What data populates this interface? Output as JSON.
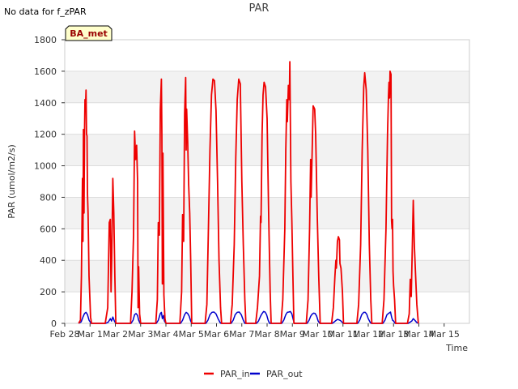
{
  "note": "No data for f_zPAR",
  "badge": "BA_met",
  "colors": {
    "PAR_in": "#ee0000",
    "PAR_out": "#0000cc",
    "band": "#f2f2f2",
    "grid": "#dddddd",
    "badge_fill": "#ffffcc",
    "badge_text": "#990000"
  },
  "chart_data": {
    "type": "line",
    "title": "PAR",
    "xlabel": "Time",
    "ylabel": "PAR (umol/m2/s)",
    "ylim": [
      0,
      1800
    ],
    "xlim": [
      0,
      16
    ],
    "yticks": [
      0,
      200,
      400,
      600,
      800,
      1000,
      1200,
      1400,
      1600,
      1800
    ],
    "xticks": [
      {
        "x": 0,
        "label": "Feb 28"
      },
      {
        "x": 1,
        "label": "Mar 1"
      },
      {
        "x": 2,
        "label": "Mar 2"
      },
      {
        "x": 3,
        "label": "Mar 3"
      },
      {
        "x": 4,
        "label": "Mar 4"
      },
      {
        "x": 5,
        "label": "Mar 5"
      },
      {
        "x": 6,
        "label": "Mar 6"
      },
      {
        "x": 7,
        "label": "Mar 7"
      },
      {
        "x": 8,
        "label": "Mar 8"
      },
      {
        "x": 9,
        "label": "Mar 9"
      },
      {
        "x": 10,
        "label": "Mar 10"
      },
      {
        "x": 11,
        "label": "Mar 11"
      },
      {
        "x": 12,
        "label": "Mar 12"
      },
      {
        "x": 13,
        "label": "Mar 13"
      },
      {
        "x": 14,
        "label": "Mar 14"
      },
      {
        "x": 15,
        "label": "Mar 15"
      }
    ],
    "grid": true,
    "legend_position": "bottom",
    "series": [
      {
        "name": "PAR_in",
        "points": [
          [
            0.55,
            0
          ],
          [
            0.62,
            20
          ],
          [
            0.66,
            300
          ],
          [
            0.7,
            920
          ],
          [
            0.72,
            520
          ],
          [
            0.74,
            1230
          ],
          [
            0.76,
            700
          ],
          [
            0.78,
            1200
          ],
          [
            0.8,
            1420
          ],
          [
            0.82,
            1360
          ],
          [
            0.84,
            1480
          ],
          [
            0.86,
            1200
          ],
          [
            0.88,
            1190
          ],
          [
            0.9,
            820
          ],
          [
            0.92,
            700
          ],
          [
            0.96,
            300
          ],
          [
            1.02,
            40
          ],
          [
            1.06,
            0
          ],
          [
            1.6,
            0
          ],
          [
            1.7,
            100
          ],
          [
            1.76,
            640
          ],
          [
            1.8,
            660
          ],
          [
            1.83,
            200
          ],
          [
            1.86,
            420
          ],
          [
            1.9,
            920
          ],
          [
            1.94,
            700
          ],
          [
            1.98,
            300
          ],
          [
            2.02,
            0
          ],
          [
            2.6,
            0
          ],
          [
            2.66,
            200
          ],
          [
            2.72,
            560
          ],
          [
            2.76,
            1220
          ],
          [
            2.8,
            1040
          ],
          [
            2.84,
            1130
          ],
          [
            2.88,
            900
          ],
          [
            2.9,
            100
          ],
          [
            2.92,
            360
          ],
          [
            2.96,
            60
          ],
          [
            3.0,
            0
          ],
          [
            3.6,
            0
          ],
          [
            3.66,
            150
          ],
          [
            3.7,
            640
          ],
          [
            3.74,
            560
          ],
          [
            3.78,
            1360
          ],
          [
            3.82,
            1550
          ],
          [
            3.84,
            1200
          ],
          [
            3.86,
            250
          ],
          [
            3.88,
            1080
          ],
          [
            3.92,
            180
          ],
          [
            3.96,
            30
          ],
          [
            4.0,
            0
          ],
          [
            4.55,
            0
          ],
          [
            4.62,
            200
          ],
          [
            4.66,
            690
          ],
          [
            4.7,
            520
          ],
          [
            4.74,
            1330
          ],
          [
            4.78,
            1560
          ],
          [
            4.8,
            1100
          ],
          [
            4.82,
            1360
          ],
          [
            4.86,
            1150
          ],
          [
            4.9,
            880
          ],
          [
            4.94,
            700
          ],
          [
            4.98,
            400
          ],
          [
            5.02,
            0
          ],
          [
            5.55,
            0
          ],
          [
            5.62,
            120
          ],
          [
            5.68,
            600
          ],
          [
            5.74,
            1100
          ],
          [
            5.8,
            1450
          ],
          [
            5.86,
            1550
          ],
          [
            5.92,
            1540
          ],
          [
            5.98,
            1350
          ],
          [
            6.04,
            900
          ],
          [
            6.1,
            400
          ],
          [
            6.16,
            100
          ],
          [
            6.2,
            0
          ],
          [
            6.55,
            0
          ],
          [
            6.62,
            120
          ],
          [
            6.7,
            500
          ],
          [
            6.76,
            1050
          ],
          [
            6.82,
            1420
          ],
          [
            6.88,
            1550
          ],
          [
            6.94,
            1520
          ],
          [
            7.0,
            900
          ],
          [
            7.06,
            500
          ],
          [
            7.12,
            150
          ],
          [
            7.16,
            0
          ],
          [
            7.55,
            0
          ],
          [
            7.62,
            100
          ],
          [
            7.7,
            300
          ],
          [
            7.74,
            680
          ],
          [
            7.76,
            640
          ],
          [
            7.8,
            1200
          ],
          [
            7.84,
            1450
          ],
          [
            7.88,
            1530
          ],
          [
            7.94,
            1500
          ],
          [
            8.0,
            1300
          ],
          [
            8.06,
            700
          ],
          [
            8.12,
            200
          ],
          [
            8.16,
            0
          ],
          [
            8.55,
            0
          ],
          [
            8.62,
            150
          ],
          [
            8.7,
            600
          ],
          [
            8.74,
            1100
          ],
          [
            8.78,
            1420
          ],
          [
            8.8,
            1280
          ],
          [
            8.84,
            1510
          ],
          [
            8.88,
            1420
          ],
          [
            8.9,
            1660
          ],
          [
            8.94,
            900
          ],
          [
            8.98,
            650
          ],
          [
            9.02,
            300
          ],
          [
            9.06,
            0
          ],
          [
            9.55,
            0
          ],
          [
            9.62,
            150
          ],
          [
            9.68,
            600
          ],
          [
            9.72,
            1040
          ],
          [
            9.74,
            800
          ],
          [
            9.78,
            1070
          ],
          [
            9.82,
            1380
          ],
          [
            9.88,
            1360
          ],
          [
            9.92,
            1200
          ],
          [
            9.98,
            700
          ],
          [
            10.04,
            300
          ],
          [
            10.1,
            0
          ],
          [
            10.55,
            0
          ],
          [
            10.62,
            100
          ],
          [
            10.68,
            300
          ],
          [
            10.72,
            400
          ],
          [
            10.74,
            350
          ],
          [
            10.78,
            520
          ],
          [
            10.82,
            550
          ],
          [
            10.86,
            530
          ],
          [
            10.88,
            380
          ],
          [
            10.92,
            350
          ],
          [
            10.98,
            200
          ],
          [
            11.02,
            0
          ],
          [
            11.55,
            0
          ],
          [
            11.62,
            120
          ],
          [
            11.7,
            500
          ],
          [
            11.76,
            1100
          ],
          [
            11.82,
            1500
          ],
          [
            11.86,
            1590
          ],
          [
            11.92,
            1480
          ],
          [
            11.98,
            1100
          ],
          [
            12.04,
            500
          ],
          [
            12.1,
            150
          ],
          [
            12.14,
            0
          ],
          [
            12.55,
            0
          ],
          [
            12.62,
            150
          ],
          [
            12.7,
            600
          ],
          [
            12.76,
            1200
          ],
          [
            12.8,
            1450
          ],
          [
            12.82,
            1530
          ],
          [
            12.84,
            1430
          ],
          [
            12.86,
            1600
          ],
          [
            12.9,
            1580
          ],
          [
            12.92,
            650
          ],
          [
            12.94,
            600
          ],
          [
            12.96,
            660
          ],
          [
            12.98,
            330
          ],
          [
            13.0,
            240
          ],
          [
            13.04,
            150
          ],
          [
            13.08,
            0
          ],
          [
            13.55,
            0
          ],
          [
            13.62,
            60
          ],
          [
            13.66,
            280
          ],
          [
            13.7,
            170
          ],
          [
            13.74,
            480
          ],
          [
            13.78,
            780
          ],
          [
            13.82,
            500
          ],
          [
            13.86,
            350
          ],
          [
            13.92,
            120
          ],
          [
            13.98,
            0
          ]
        ]
      },
      {
        "name": "PAR_out",
        "points": [
          [
            0.55,
            0
          ],
          [
            0.65,
            10
          ],
          [
            0.72,
            40
          ],
          [
            0.78,
            62
          ],
          [
            0.84,
            70
          ],
          [
            0.9,
            55
          ],
          [
            0.96,
            20
          ],
          [
            1.04,
            0
          ],
          [
            1.62,
            0
          ],
          [
            1.72,
            8
          ],
          [
            1.8,
            30
          ],
          [
            1.85,
            15
          ],
          [
            1.9,
            40
          ],
          [
            1.96,
            15
          ],
          [
            2.02,
            0
          ],
          [
            2.62,
            0
          ],
          [
            2.7,
            20
          ],
          [
            2.76,
            55
          ],
          [
            2.82,
            62
          ],
          [
            2.88,
            50
          ],
          [
            2.92,
            20
          ],
          [
            2.98,
            0
          ],
          [
            3.62,
            0
          ],
          [
            3.7,
            20
          ],
          [
            3.78,
            62
          ],
          [
            3.82,
            70
          ],
          [
            3.86,
            30
          ],
          [
            3.9,
            50
          ],
          [
            3.94,
            15
          ],
          [
            4.0,
            0
          ],
          [
            4.58,
            0
          ],
          [
            4.66,
            20
          ],
          [
            4.74,
            55
          ],
          [
            4.8,
            70
          ],
          [
            4.86,
            62
          ],
          [
            4.92,
            45
          ],
          [
            4.98,
            15
          ],
          [
            5.02,
            0
          ],
          [
            5.58,
            0
          ],
          [
            5.66,
            20
          ],
          [
            5.74,
            55
          ],
          [
            5.82,
            70
          ],
          [
            5.9,
            72
          ],
          [
            5.98,
            60
          ],
          [
            6.06,
            30
          ],
          [
            6.14,
            5
          ],
          [
            6.18,
            0
          ],
          [
            6.58,
            0
          ],
          [
            6.66,
            20
          ],
          [
            6.74,
            55
          ],
          [
            6.82,
            70
          ],
          [
            6.9,
            72
          ],
          [
            6.98,
            55
          ],
          [
            7.06,
            20
          ],
          [
            7.12,
            0
          ],
          [
            7.58,
            0
          ],
          [
            7.66,
            15
          ],
          [
            7.74,
            45
          ],
          [
            7.8,
            62
          ],
          [
            7.86,
            75
          ],
          [
            7.92,
            72
          ],
          [
            7.98,
            55
          ],
          [
            8.04,
            20
          ],
          [
            8.1,
            0
          ],
          [
            8.58,
            0
          ],
          [
            8.66,
            20
          ],
          [
            8.74,
            55
          ],
          [
            8.8,
            70
          ],
          [
            8.86,
            72
          ],
          [
            8.92,
            75
          ],
          [
            8.98,
            60
          ],
          [
            9.04,
            20
          ],
          [
            9.08,
            0
          ],
          [
            9.58,
            0
          ],
          [
            9.66,
            20
          ],
          [
            9.72,
            45
          ],
          [
            9.78,
            58
          ],
          [
            9.84,
            65
          ],
          [
            9.9,
            62
          ],
          [
            9.96,
            45
          ],
          [
            10.02,
            15
          ],
          [
            10.08,
            0
          ],
          [
            10.58,
            0
          ],
          [
            10.66,
            10
          ],
          [
            10.72,
            18
          ],
          [
            10.78,
            25
          ],
          [
            10.84,
            22
          ],
          [
            10.9,
            18
          ],
          [
            10.96,
            8
          ],
          [
            11.02,
            0
          ],
          [
            11.58,
            0
          ],
          [
            11.66,
            20
          ],
          [
            11.74,
            55
          ],
          [
            11.82,
            70
          ],
          [
            11.88,
            70
          ],
          [
            11.94,
            58
          ],
          [
            12.0,
            30
          ],
          [
            12.08,
            5
          ],
          [
            12.12,
            0
          ],
          [
            12.58,
            0
          ],
          [
            12.66,
            20
          ],
          [
            12.74,
            55
          ],
          [
            12.82,
            65
          ],
          [
            12.88,
            72
          ],
          [
            12.92,
            40
          ],
          [
            12.96,
            20
          ],
          [
            13.0,
            15
          ],
          [
            13.06,
            0
          ],
          [
            13.58,
            0
          ],
          [
            13.66,
            8
          ],
          [
            13.72,
            15
          ],
          [
            13.78,
            30
          ],
          [
            13.84,
            20
          ],
          [
            13.9,
            8
          ],
          [
            13.96,
            0
          ]
        ]
      }
    ]
  }
}
